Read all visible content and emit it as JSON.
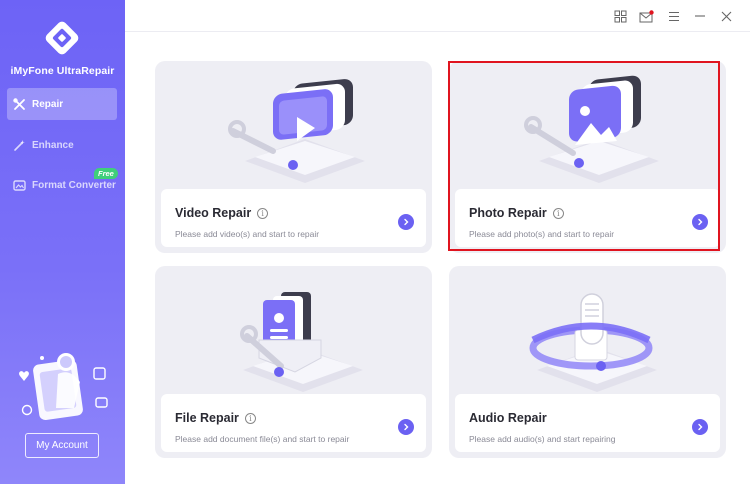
{
  "app": {
    "name": "iMyFone UltraRepair"
  },
  "sidebar": {
    "items": [
      {
        "label": "Repair",
        "icon": "wrench-cross-icon",
        "active": true
      },
      {
        "label": "Enhance",
        "icon": "magic-wand-icon",
        "active": false
      },
      {
        "label": "Format Converter",
        "icon": "image-convert-icon",
        "active": false,
        "badge": "Free"
      }
    ],
    "account_label": "My Account"
  },
  "toolbar": {
    "icons": [
      "grid-icon",
      "mail-icon",
      "menu-icon",
      "minimize-icon",
      "close-icon"
    ]
  },
  "cards": [
    {
      "title": "Video Repair",
      "subtitle": "Please add video(s) and start to repair",
      "icon": "video-icon",
      "highlighted": false
    },
    {
      "title": "Photo Repair",
      "subtitle": "Please add photo(s) and start to repair",
      "icon": "photo-icon",
      "highlighted": true
    },
    {
      "title": "File Repair",
      "subtitle": "Please add document file(s) and start to repair",
      "icon": "document-icon",
      "highlighted": false
    },
    {
      "title": "Audio Repair",
      "subtitle": "Please add audio(s) and start repairing",
      "icon": "microphone-icon",
      "highlighted": false
    }
  ],
  "colors": {
    "accent": "#6b61f2",
    "sidebar_top": "#6d63f6",
    "sidebar_bottom": "#8f86fa",
    "highlight": "#e0141f",
    "badge": "#3fcf7a"
  }
}
